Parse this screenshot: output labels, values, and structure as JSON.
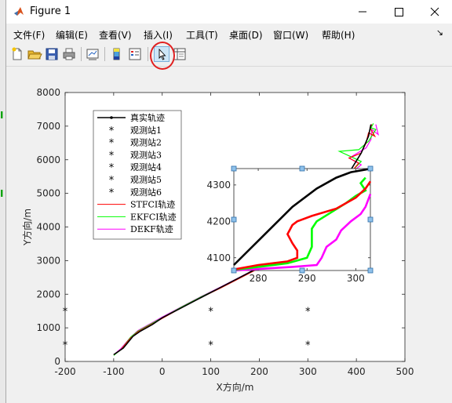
{
  "window": {
    "title": "Figure 1"
  },
  "menu": [
    "文件(F)",
    "编辑(E)",
    "查看(V)",
    "插入(I)",
    "工具(T)",
    "桌面(D)",
    "窗口(W)",
    "帮助(H)"
  ],
  "toolbar": [
    "new-figure-icon",
    "open-icon",
    "save-icon",
    "print-icon",
    "link-plot-icon",
    "insert-colorbar-icon",
    "insert-legend-icon",
    "edit-plot-arrow-icon",
    "property-inspector-icon"
  ],
  "chart_data": [
    {
      "type": "line",
      "xlabel": "X方向/m",
      "ylabel": "Y方向/m",
      "xlim": [
        -200,
        500
      ],
      "ylim": [
        0,
        8000
      ],
      "xticks": [
        "-200",
        "-100",
        "0",
        "100",
        "200",
        "300",
        "400",
        "500"
      ],
      "yticks": [
        "0",
        "1000",
        "2000",
        "3000",
        "4000",
        "5000",
        "6000",
        "7000",
        "8000"
      ],
      "legend_position": "top-left",
      "legend": [
        "真实轨迹",
        "观测站1",
        "观测站2",
        "观测站3",
        "观测站4",
        "观测站5",
        "观测站6",
        "STFCI轨迹",
        "EKFCI轨迹",
        "DEKF轨迹"
      ],
      "colors": {
        "truth": "#000000",
        "stfci": "#ff0000",
        "ekfci": "#00ff00",
        "dekf": "#ff00ff"
      },
      "stations": [
        {
          "name": "观测站1",
          "x": -200,
          "y": 500
        },
        {
          "name": "观测站2",
          "x": -200,
          "y": 1500
        },
        {
          "name": "观测站3",
          "x": 100,
          "y": 500
        },
        {
          "name": "观测站4",
          "x": 100,
          "y": 1500
        },
        {
          "name": "观测站5",
          "x": 300,
          "y": 500
        },
        {
          "name": "观测站6",
          "x": 300,
          "y": 1500
        }
      ],
      "series": [
        {
          "name": "真实轨迹",
          "x": [
            -100,
            -80,
            -60,
            -45,
            -20,
            0,
            40,
            80,
            120,
            160,
            200,
            240,
            280,
            300,
            340,
            380,
            410,
            425,
            430
          ],
          "y": [
            200,
            400,
            750,
            900,
            1100,
            1300,
            1600,
            1900,
            2200,
            2500,
            2800,
            3200,
            3700,
            4000,
            4700,
            5500,
            6200,
            6700,
            7050
          ]
        },
        {
          "name": "STFCI轨迹",
          "x": [
            -100,
            -85,
            -65,
            -50,
            -25,
            0,
            40,
            80,
            120,
            160,
            200,
            240,
            280,
            300,
            340,
            380,
            405,
            385,
            410,
            420,
            425,
            438,
            428,
            432
          ],
          "y": [
            200,
            350,
            700,
            880,
            1080,
            1280,
            1600,
            1900,
            2180,
            2480,
            2780,
            3180,
            3680,
            3980,
            4680,
            5480,
            5900,
            6050,
            6200,
            6500,
            6800,
            6700,
            6950,
            7050
          ]
        },
        {
          "name": "EKFCI轨迹",
          "x": [
            -100,
            -85,
            -65,
            -50,
            -25,
            0,
            40,
            80,
            120,
            160,
            200,
            240,
            280,
            300,
            340,
            380,
            410,
            365,
            405,
            425,
            440,
            430,
            435
          ],
          "y": [
            180,
            350,
            720,
            900,
            1100,
            1300,
            1620,
            1920,
            2200,
            2500,
            2800,
            3200,
            3700,
            4000,
            4700,
            5500,
            5950,
            6250,
            6300,
            6550,
            6900,
            6950,
            7080
          ]
        },
        {
          "name": "DEKF轨迹",
          "x": [
            -100,
            -85,
            -65,
            -50,
            -25,
            0,
            40,
            80,
            120,
            160,
            200,
            240,
            280,
            300,
            340,
            380,
            410,
            385,
            420,
            430,
            432,
            445,
            440
          ],
          "y": [
            200,
            380,
            720,
            920,
            1120,
            1320,
            1630,
            1930,
            2210,
            2510,
            2810,
            3210,
            3710,
            4010,
            4710,
            5510,
            5850,
            6050,
            6350,
            6600,
            6900,
            6750,
            7050
          ]
        }
      ]
    },
    {
      "type": "line",
      "xlim": [
        275,
        303
      ],
      "ylim": [
        4065,
        4345
      ],
      "xticks": [
        "280",
        "290",
        "300"
      ],
      "yticks": [
        "4100",
        "4200",
        "4300"
      ],
      "series": [
        {
          "name": "真实轨迹",
          "x": [
            275,
            281,
            287,
            292,
            296,
            299,
            302,
            303
          ],
          "y": [
            4080,
            4160,
            4240,
            4290,
            4320,
            4335,
            4342,
            4345
          ]
        },
        {
          "name": "STFCI轨迹",
          "x": [
            275,
            280,
            286,
            288,
            288,
            287,
            286,
            287,
            288,
            291,
            296,
            300,
            302,
            303
          ],
          "y": [
            4068,
            4080,
            4090,
            4100,
            4120,
            4140,
            4165,
            4190,
            4200,
            4215,
            4235,
            4265,
            4290,
            4310
          ]
        },
        {
          "name": "EKFCI轨迹",
          "x": [
            275,
            280,
            286,
            290,
            291,
            291,
            291,
            292,
            295,
            298,
            300,
            302,
            301,
            302
          ],
          "y": [
            4067,
            4075,
            4085,
            4100,
            4130,
            4160,
            4180,
            4200,
            4225,
            4250,
            4270,
            4285,
            4305,
            4320
          ]
        },
        {
          "name": "DEKF轨迹",
          "x": [
            275,
            281,
            287,
            292,
            293,
            294,
            296,
            297,
            299,
            301,
            302,
            303
          ],
          "y": [
            4065,
            4070,
            4075,
            4080,
            4100,
            4130,
            4150,
            4175,
            4200,
            4220,
            4240,
            4275
          ]
        }
      ]
    }
  ]
}
